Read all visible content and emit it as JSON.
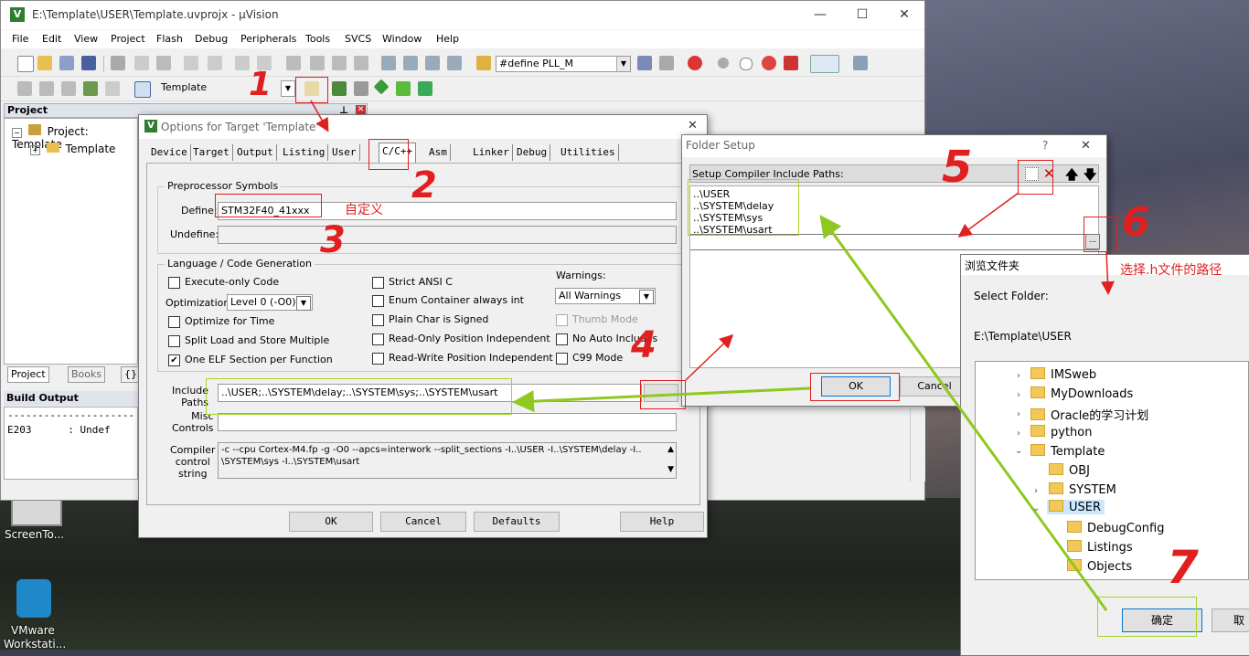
{
  "window": {
    "title": "E:\\Template\\USER\\Template.uvprojx - µVision",
    "minimize": "—",
    "maximize": "☐",
    "close": "✕"
  },
  "menu": [
    "File",
    "Edit",
    "View",
    "Project",
    "Flash",
    "Debug",
    "Peripherals",
    "Tools",
    "SVCS",
    "Window",
    "Help"
  ],
  "toolbar": {
    "define_combo": "#define PLL_M",
    "target_combo": "Template"
  },
  "project_pane": {
    "header": "Project",
    "root": "Project: Template",
    "child": "Template",
    "tabs": [
      "Project",
      "Books",
      "{}"
    ]
  },
  "build_output": {
    "header": "Build Output",
    "lines": [
      "----------------------------------",
      "E203      : Undef"
    ]
  },
  "options_dialog": {
    "title": "Options for Target 'Template'",
    "close": "✕",
    "tabs": [
      "Device",
      "Target",
      "Output",
      "Listing",
      "User",
      "C/C++",
      "Asm",
      "Linker",
      "Debug",
      "Utilities"
    ],
    "preprocessor_group": "Preprocessor Symbols",
    "define_label": "Define:",
    "define_value": "STM32F40_41xxx",
    "undefine_label": "Undefine:",
    "language_group": "Language / Code Generation",
    "execute_only": "Execute-only Code",
    "optimization_label": "Optimization:",
    "optimization_value": "Level 0 (-O0)",
    "optimize_time": "Optimize for Time",
    "split_load": "Split Load and Store Multiple",
    "one_elf": "One ELF Section per Function",
    "strict_ansi": "Strict ANSI C",
    "enum_container": "Enum Container always int",
    "plain_char": "Plain Char is Signed",
    "ro_pos": "Read-Only Position Independent",
    "rw_pos": "Read-Write Position Independent",
    "warnings_label": "Warnings:",
    "warnings_value": "All Warnings",
    "thumb_mode": "Thumb Mode",
    "no_auto_includes": "No Auto Includes",
    "c99_mode": "C99 Mode",
    "include_paths_label": "Include\nPaths",
    "include_paths_value": "..\\USER;..\\SYSTEM\\delay;..\\SYSTEM\\sys;..\\SYSTEM\\usart",
    "misc_label": "Misc\nControls",
    "compiler_label": "Compiler\ncontrol\nstring",
    "compiler_line1": "-c --cpu Cortex-M4.fp -g -O0 --apcs=interwork --split_sections -I..\\USER -I..\\SYSTEM\\delay -I..",
    "compiler_line2": "\\SYSTEM\\sys -I..\\SYSTEM\\usart",
    "ok": "OK",
    "cancel": "Cancel",
    "defaults": "Defaults",
    "help": "Help"
  },
  "folder_setup": {
    "title": "Folder Setup",
    "help": "?",
    "close": "✕",
    "label": "Setup Compiler Include Paths:",
    "paths": [
      "..\\USER",
      "..\\SYSTEM\\delay",
      "..\\SYSTEM\\sys",
      "..\\SYSTEM\\usart"
    ],
    "browse": "...",
    "ok": "OK",
    "cancel": "Cancel"
  },
  "browse_folder": {
    "title": "浏览文件夹",
    "select_label": "Select Folder:",
    "path": "E:\\Template\\USER",
    "nodes": [
      "IMSweb",
      "MyDownloads",
      "Oracle的学习计划",
      "python",
      "Template",
      "OBJ",
      "SYSTEM",
      "USER",
      "DebugConfig",
      "Listings",
      "Objects"
    ],
    "ok": "确定",
    "cancel": "取"
  },
  "annotations": {
    "n1": "1",
    "n2": "2",
    "n3": "3",
    "n4": "4",
    "n5": "5",
    "n6": "6",
    "n7": "7",
    "custom": "自定义",
    "choose_path": "选择.h文件的路径"
  },
  "desktop": {
    "screen_icon_label": "ScreenTo...",
    "vmware_label_1": "VMware",
    "vmware_label_2": "Workstati..."
  }
}
